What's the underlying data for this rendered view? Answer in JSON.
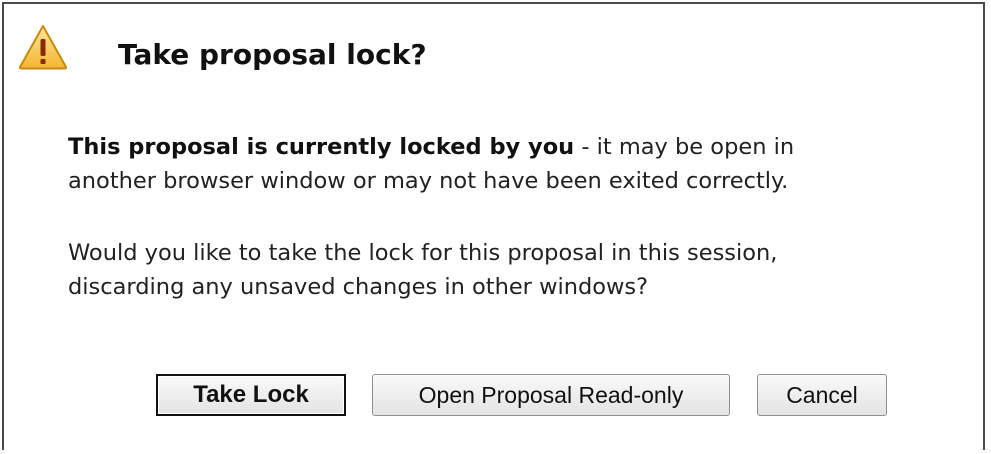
{
  "dialog": {
    "icon": "warning-triangle-icon",
    "title": "Take proposal lock?",
    "message1_bold": "This proposal is currently locked by you",
    "message1_rest_line1": " - it may be open in",
    "message1_line2": "another browser window or may not have been exited correctly.",
    "message2_line1": "Would you like to take the lock for this proposal in this session,",
    "message2_line2": "discarding any unsaved changes in other windows?",
    "buttons": {
      "take_lock": "Take Lock",
      "open_read_only": "Open Proposal Read-only",
      "cancel": "Cancel"
    },
    "colors": {
      "warning_fill": "#f6c342",
      "warning_border": "#c98a10",
      "warning_mark": "#8a2a00"
    }
  }
}
